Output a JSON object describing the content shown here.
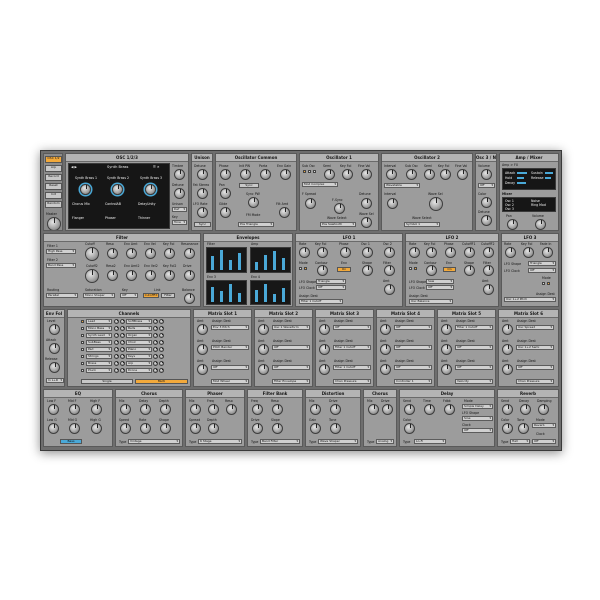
{
  "plugin": {
    "accent_color": "#f2a93b",
    "display_color": "#4aa9d8",
    "sidebar": {
      "buttons": [
        "OSC 1/2",
        "Arp",
        "Record",
        "Reset",
        "Init",
        "Random",
        "Master"
      ]
    },
    "osc": {
      "title": "OSC 1/2/3",
      "preset_name": "Synth Brass",
      "display_slots": [
        {
          "title": "Synth Brass 1",
          "sub1": "Chorus Mix",
          "sub2": "Flanger"
        },
        {
          "title": "Synth Brass 2",
          "sub1": "ControlAB",
          "sub2": "Phaser"
        },
        {
          "title": "Synth Brass 3",
          "sub1": "DelayUnity",
          "sub2": "Thinner"
        }
      ],
      "knob_labels": [
        "Timbre",
        "Detune",
        "Unison",
        "Key"
      ],
      "knob_values": [
        "0.00",
        "Def",
        "Tone"
      ]
    },
    "unison": {
      "title": "Unison",
      "labels": [
        "Detune",
        "Fat Stereo",
        "LFO Rate",
        "Sync"
      ]
    },
    "osc_common": {
      "title": "Oscillator Common",
      "labels": [
        "Phase",
        "Init PW",
        "Porta",
        "Env Gain",
        "Pan",
        "Glide",
        "Env Fil",
        "Sync PW",
        "FM Mode",
        "Filt Amt"
      ],
      "buttons": [
        "Sync",
        "Pos Triangle"
      ]
    },
    "osc1": {
      "title": "Oscillator 1",
      "labels": [
        "Sub Osc",
        "Semi",
        "Key Fol",
        "Fine Vol",
        "F Spread",
        "F-Sync",
        "Detune",
        "Wave Select",
        "Wave Sel"
      ],
      "buttons": [
        "Saw",
        "Tri",
        "Puls",
        "Mod Complex",
        "Pos Sawtooth"
      ]
    },
    "osc2": {
      "title": "Oscillator 2",
      "labels": [
        "Interval",
        "Sub Osc",
        "Semi",
        "Key Fol",
        "Fine Vol",
        "Wave Sel",
        "Wave Select"
      ],
      "buttons": [
        "Wavetable",
        "Symbol 1"
      ]
    },
    "osc3": {
      "title": "Osc 3 / N",
      "labels": [
        "Volume",
        "Noise",
        "Color",
        "Detune"
      ],
      "buttons": [
        "Off"
      ]
    },
    "amp": {
      "title": "Amp / Mixer",
      "labels": [
        "Amp > FX",
        "Attack",
        "Hold",
        "Decay",
        "Sustain",
        "Release",
        "Mixer",
        "Osc 1",
        "Osc 2",
        "Osc 3",
        "Noise",
        "Ring Mod",
        "Pan",
        "Volume"
      ]
    },
    "filter": {
      "title": "Filter",
      "labels": [
        "Filter 1",
        "Filter 2",
        "Cutoff",
        "Reso",
        "Env Amt",
        "Env Vel",
        "Key Fol",
        "Resonance",
        "Drive",
        "Cutoff2",
        "Reso2",
        "Env Amt2",
        "Env Vel2",
        "Key Fol2",
        "Routing",
        "Saturation",
        "Key",
        "Link",
        "Balance",
        "Cutoff Link"
      ],
      "dropdowns": [
        "High Pass",
        "Band Pass",
        "Parallel",
        "Mono Shaper",
        "Off"
      ],
      "buttons": [
        "CutoffFX",
        "Filter"
      ]
    },
    "envelopes": {
      "title": "Envelopes",
      "labels": [
        "Filter",
        "Amp",
        "Env 3",
        "Env 4",
        "Attack",
        "Decay",
        "Sustain",
        "Release"
      ]
    },
    "lfo1": {
      "title": "LFO 1",
      "labels": [
        "Rate",
        "Key Fol",
        "Phase",
        "Osc 1",
        "Osc 2",
        "Mode",
        "Contour",
        "Env",
        "Shape",
        "Filter",
        "Amt",
        "Assign Dest",
        "LFO Shape",
        "LFO Clock"
      ],
      "dropdowns": [
        "Triangle",
        "Off",
        "Filter 1 Cutoff",
        "Off"
      ],
      "buttons": [
        "On"
      ]
    },
    "lfo2": {
      "title": "LFO 2",
      "labels": [
        "Rate",
        "Key Fol",
        "Phase",
        "CutoffF1",
        "CutoffF2",
        "Mode",
        "Contour",
        "Env",
        "Shape",
        "Filter",
        "Amt",
        "LFO Shape",
        "LFO Clock",
        "Assign Dest"
      ],
      "dropdowns": [
        "Saw",
        "Off",
        "Osc Balance"
      ],
      "buttons": [
        "On"
      ]
    },
    "lfo3": {
      "title": "LFO 3",
      "labels": [
        "Rate",
        "Key Fol",
        "Fade In",
        "LFO Shape",
        "LFO Clock",
        "Mode",
        "Assign Dest"
      ],
      "dropdowns": [
        "Triangle",
        "Off",
        "Osc 1+2 Pitch"
      ]
    },
    "arp": {
      "title": "Env Fol",
      "labels": [
        "Level",
        "Attack",
        "Release",
        "Contour"
      ],
      "dropdowns": [
        "In L+R"
      ]
    },
    "channels": {
      "title": "Channels",
      "labels": [
        "Single",
        "Multi"
      ],
      "rows": [
        "Lead",
        "Mono Bass",
        "Synth Lead",
        "SubBass",
        "Pad",
        "Strings",
        "Brass",
        "Pluck"
      ],
      "rows_b": [
        "SoftBrass",
        "Bells",
        "Organ",
        "Choir",
        "Piano",
        "Keys",
        "Arp",
        "Drone"
      ]
    },
    "matrix": [
      {
        "title": "Matrix Slot 1",
        "labels": [
          "Assign Dest",
          "Amt",
          "Assign Dest",
          "Amt",
          "Assign Dest"
        ],
        "sources": [
          "Env 3 Pitch",
          "Pitch Bender",
          "Off",
          "Mod Wheel"
        ]
      },
      {
        "title": "Matrix Slot 2",
        "labels": [
          "Assign Dest",
          "Amt",
          "Assign Dest",
          "Amt"
        ],
        "sources": [
          "Osc 1 Waveform",
          "Off",
          "Off",
          "Filter Envelope"
        ]
      },
      {
        "title": "Matrix Slot 3",
        "labels": [
          "Assign Dest",
          "Amt",
          "Assign Dest",
          "Amt"
        ],
        "sources": [
          "Off",
          "Filter 1 Cutoff",
          "Filter 1 Cutoff",
          "Chan Pressure"
        ]
      },
      {
        "title": "Matrix Slot 4",
        "labels": [
          "Assign Dest",
          "Amt",
          "Assign Dest",
          "Amt"
        ],
        "sources": [
          "Off",
          "Off",
          "Off",
          "Controller 1"
        ]
      },
      {
        "title": "Matrix Slot 5",
        "labels": [
          "Assign Dest",
          "Amt",
          "Assign Dest",
          "Amt"
        ],
        "sources": [
          "Filter 1 Cutoff",
          "Off",
          "Off",
          "Velocity"
        ]
      },
      {
        "title": "Matrix Slot 6",
        "labels": [
          "Assign Dest",
          "Amt",
          "Assign Dest",
          "Amt"
        ],
        "sources": [
          "Osc Spread",
          "Osc 1+2 Semi",
          "Off",
          "Chan Pressure"
        ]
      }
    ],
    "eq": {
      "title": "EQ",
      "labels": [
        "Low F",
        "Mid F",
        "High F",
        "Low G",
        "Mid G",
        "High G",
        "Mid Q"
      ],
      "buttons": [
        "Bass"
      ]
    },
    "chorus": {
      "title": "Chorus",
      "labels": [
        "Mix",
        "Delay",
        "Depth",
        "Speed",
        "Rate",
        "Shape",
        "Type"
      ],
      "dropdowns": [
        "Vintage"
      ]
    },
    "phaser": {
      "title": "Phaser",
      "labels": [
        "Mix",
        "Freq",
        "Reso",
        "Spread",
        "Depth",
        "Type"
      ],
      "dropdowns": [
        "6 Stage"
      ]
    },
    "filterbank": {
      "title": "Filter Bank",
      "labels": [
        "Freq",
        "Reso",
        "Drive",
        "Slope",
        "Type"
      ],
      "dropdowns": [
        "Band Filter"
      ]
    },
    "distortion": {
      "title": "Distortion",
      "labels": [
        "Mix",
        "Drive",
        "Gain",
        "Tone",
        "Type"
      ],
      "dropdowns": [
        "Wave Shaper"
      ]
    },
    "character": {
      "title": "Chorus",
      "labels": [
        "Mix",
        "Drive",
        "Type"
      ],
      "dropdowns": [
        "Analog"
      ]
    },
    "delay": {
      "title": "Delay",
      "labels": [
        "Send",
        "Time",
        "Fdbk",
        "Mode",
        "Color",
        "LFO Shape",
        "Clock",
        "Type"
      ],
      "dropdowns": [
        "Simple Delay",
        "Sine",
        "Off",
        "Lo-Fi"
      ]
    },
    "reverb": {
      "title": "Reverb",
      "labels": [
        "Send",
        "Decay",
        "Damping",
        "Mode",
        "Color",
        "Tone",
        "Clock",
        "Type"
      ],
      "dropdowns": [
        "Reverb",
        "Hall",
        "Off"
      ]
    }
  }
}
